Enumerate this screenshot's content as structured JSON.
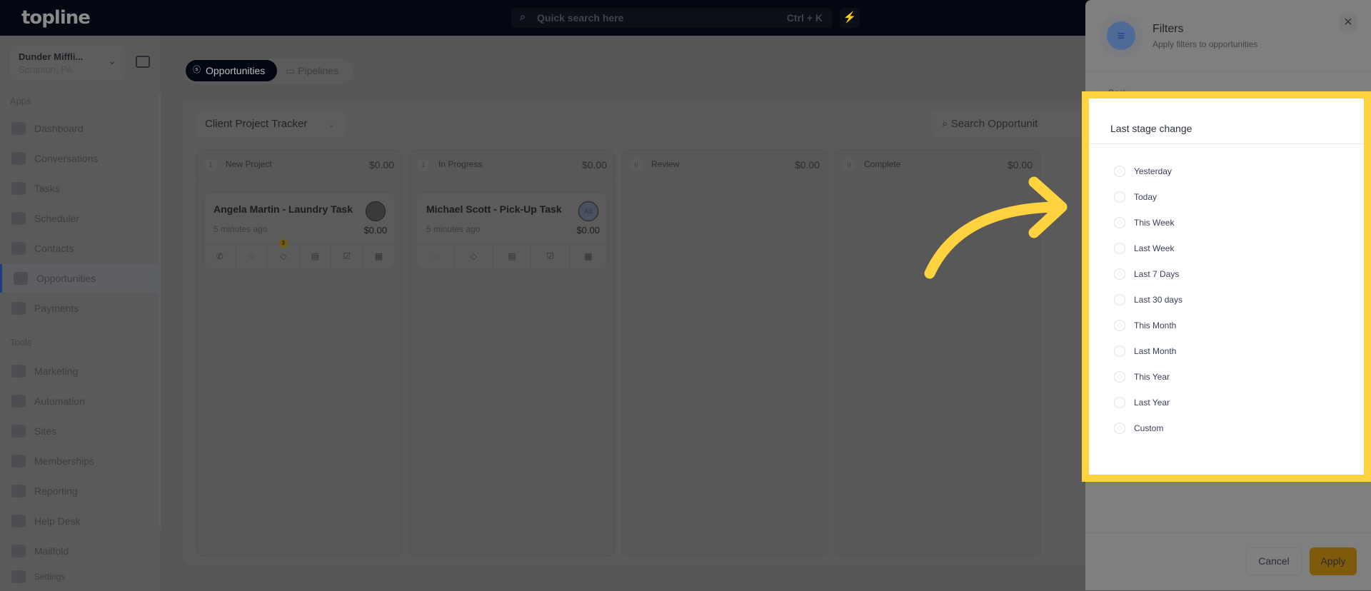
{
  "app": {
    "logo": "topline",
    "search_placeholder": "Quick search here",
    "search_shortcut": "Ctrl + K"
  },
  "sidebar": {
    "company": "Dunder Miffli...",
    "location": "Scranton, PA",
    "apps_label": "Apps",
    "apps": [
      {
        "label": "Dashboard",
        "icon": "dashboard-icon"
      },
      {
        "label": "Conversations",
        "icon": "chat-icon"
      },
      {
        "label": "Tasks",
        "icon": "task-icon"
      },
      {
        "label": "Scheduler",
        "icon": "calendar-icon"
      },
      {
        "label": "Contacts",
        "icon": "user-icon"
      },
      {
        "label": "Opportunities",
        "icon": "target-icon",
        "active": true
      },
      {
        "label": "Payments",
        "icon": "card-icon"
      }
    ],
    "tools_label": "Tools",
    "tools": [
      {
        "label": "Marketing",
        "icon": "megaphone-icon"
      },
      {
        "label": "Automation",
        "icon": "gears-icon"
      },
      {
        "label": "Sites",
        "icon": "globe-icon"
      },
      {
        "label": "Memberships",
        "icon": "users-icon"
      },
      {
        "label": "Reporting",
        "icon": "pie-icon"
      },
      {
        "label": "Help Desk",
        "icon": "help-icon"
      },
      {
        "label": "Mailfold",
        "icon": "mail-icon"
      }
    ],
    "settings": "Settings"
  },
  "tabs": [
    {
      "label": "Opportunities",
      "active": true
    },
    {
      "label": "Pipelines"
    }
  ],
  "board": {
    "pipeline": "Client Project Tracker",
    "search_placeholder": "Search Opportunit",
    "columns": [
      {
        "count": "1",
        "name": "New Project",
        "amount": "$0.00",
        "cards": [
          {
            "title": "Angela Martin - Laundry Task",
            "ago": "5 minutes ago",
            "value": "$0.00",
            "tag_badge": "3"
          }
        ]
      },
      {
        "count": "1",
        "name": "In Progress",
        "amount": "$0.00",
        "cards": [
          {
            "title": "Michael Scott - Pick-Up Task",
            "ago": "5 minutes ago",
            "value": "$0.00",
            "avatar": "AB"
          }
        ]
      },
      {
        "count": "0",
        "name": "Review",
        "amount": "$0.00",
        "cards": []
      },
      {
        "count": "0",
        "name": "Complete",
        "amount": "$0.00",
        "cards": []
      }
    ]
  },
  "filters": {
    "title": "Filters",
    "subtitle": "Apply filters to opportunities",
    "back": "Back",
    "section": "Last stage change",
    "options": [
      "Yesterday",
      "Today",
      "This Week",
      "Last Week",
      "Last 7 Days",
      "Last 30 days",
      "This Month",
      "Last Month",
      "This Year",
      "Last Year",
      "Custom"
    ],
    "cancel": "Cancel",
    "apply": "Apply"
  },
  "colors": {
    "highlight": "#ffd23f",
    "accent": "#1d3a8a"
  }
}
